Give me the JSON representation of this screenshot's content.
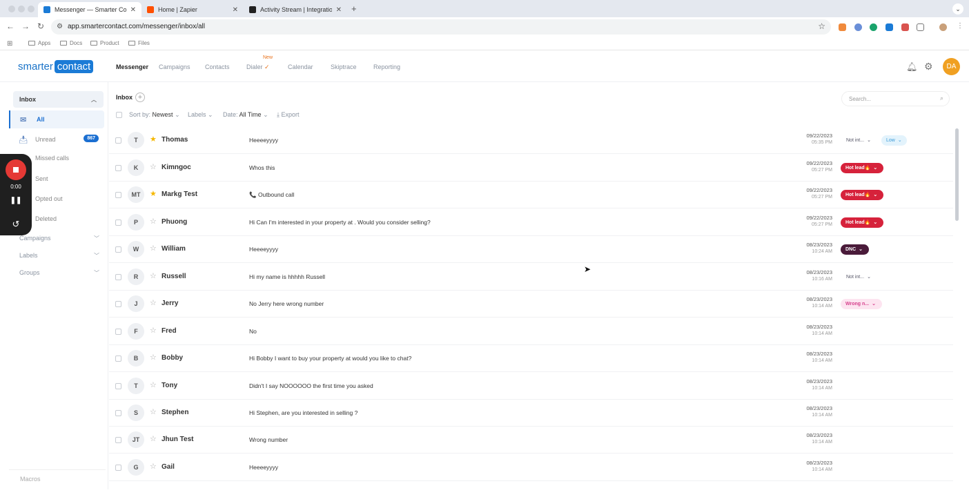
{
  "browser": {
    "tabs": [
      {
        "title": "Messenger — Smarter Conta",
        "active": true,
        "color": "#1b7bd6"
      },
      {
        "title": "Home | Zapier",
        "active": false,
        "color": "#ff4f00"
      },
      {
        "title": "Activity Stream | Integration",
        "active": false,
        "color": "#222222"
      }
    ],
    "new_tab": "+",
    "url": "app.smartercontact.com/messenger/inbox/all",
    "bookmarks": [
      "Apps",
      "Docs",
      "Product",
      "Files"
    ]
  },
  "app": {
    "logo_smarter": "smarter",
    "logo_contact": "contact",
    "nav": [
      "Messenger",
      "Campaigns",
      "Contacts",
      "Dialer",
      "Calendar",
      "Skiptrace",
      "Reporting"
    ],
    "dialer_badge": "New",
    "avatar": "DA"
  },
  "sidebar": {
    "section": "Inbox",
    "items": [
      {
        "label": "All",
        "active": true,
        "icon": "envelope-icon"
      },
      {
        "label": "Unread",
        "badge": "867",
        "icon": "inbox-icon"
      },
      {
        "label": "Missed calls"
      },
      {
        "label": "Sent"
      },
      {
        "label": "Opted out"
      },
      {
        "label": "Deleted"
      }
    ],
    "groups": [
      "Campaigns",
      "Labels",
      "Groups"
    ],
    "macros": "Macros"
  },
  "recorder": {
    "time": "0:00"
  },
  "main": {
    "title": "Inbox",
    "search_placeholder": "Search...",
    "sort_label": "Sort by:",
    "sort_value": "Newest",
    "labels": "Labels",
    "date_label": "Date:",
    "date_value": "All Time",
    "export": "Export",
    "rows": [
      {
        "initials": "T",
        "name": "Thomas",
        "starred": true,
        "message": "Heeeeyyyy",
        "date": "09/22/2023",
        "time": "05:35 PM",
        "tags": [
          {
            "type": "notint",
            "label": "Not int..."
          },
          {
            "type": "low",
            "label": "Low"
          }
        ]
      },
      {
        "initials": "K",
        "name": "Kimngoc",
        "starred": false,
        "message": "Whos this",
        "date": "09/22/2023",
        "time": "05:27 PM",
        "tags": [
          {
            "type": "hot",
            "label": "Hot lead🔥"
          }
        ]
      },
      {
        "initials": "MT",
        "name": "Markg Test",
        "starred": true,
        "message": "📞 Outbound call",
        "date": "09/22/2023",
        "time": "05:27 PM",
        "tags": [
          {
            "type": "hot",
            "label": "Hot lead🔥"
          }
        ]
      },
      {
        "initials": "P",
        "name": "Phuong",
        "starred": false,
        "message": "Hi Can I'm interested in your property at . Would you consider selling?",
        "date": "09/22/2023",
        "time": "05:27 PM",
        "tags": [
          {
            "type": "hot",
            "label": "Hot lead🔥"
          }
        ]
      },
      {
        "initials": "W",
        "name": "William",
        "starred": false,
        "message": "Heeeeyyyy",
        "date": "08/23/2023",
        "time": "10:24 AM",
        "tags": [
          {
            "type": "dnc",
            "label": "DNC"
          }
        ]
      },
      {
        "initials": "R",
        "name": "Russell",
        "starred": false,
        "message": "Hi my name is hhhhh Russell",
        "date": "08/23/2023",
        "time": "10:16 AM",
        "tags": [
          {
            "type": "notint",
            "label": "Not int..."
          }
        ]
      },
      {
        "initials": "J",
        "name": "Jerry",
        "starred": false,
        "message": "No Jerry here wrong number",
        "date": "08/23/2023",
        "time": "10:14 AM",
        "tags": [
          {
            "type": "wrong",
            "label": "Wrong n..."
          }
        ]
      },
      {
        "initials": "F",
        "name": "Fred",
        "starred": false,
        "message": "No",
        "date": "08/23/2023",
        "time": "10:14 AM",
        "tags": []
      },
      {
        "initials": "B",
        "name": "Bobby",
        "starred": false,
        "message": "Hi Bobby I want to buy your property at would you like to chat?",
        "date": "08/23/2023",
        "time": "10:14 AM",
        "tags": []
      },
      {
        "initials": "T",
        "name": "Tony",
        "starred": false,
        "message": "Didn't I say NOOOOOO the first time you asked",
        "date": "08/23/2023",
        "time": "10:14 AM",
        "tags": []
      },
      {
        "initials": "S",
        "name": "Stephen",
        "starred": false,
        "message": "Hi Stephen, are you interested in selling ?",
        "date": "08/23/2023",
        "time": "10:14 AM",
        "tags": []
      },
      {
        "initials": "JT",
        "name": "Jhun Test",
        "starred": false,
        "message": "Wrong number",
        "date": "08/23/2023",
        "time": "10:14 AM",
        "tags": []
      },
      {
        "initials": "G",
        "name": "Gail",
        "starred": false,
        "message": "Heeeeyyyy",
        "date": "08/23/2023",
        "time": "10:14 AM",
        "tags": []
      }
    ]
  }
}
